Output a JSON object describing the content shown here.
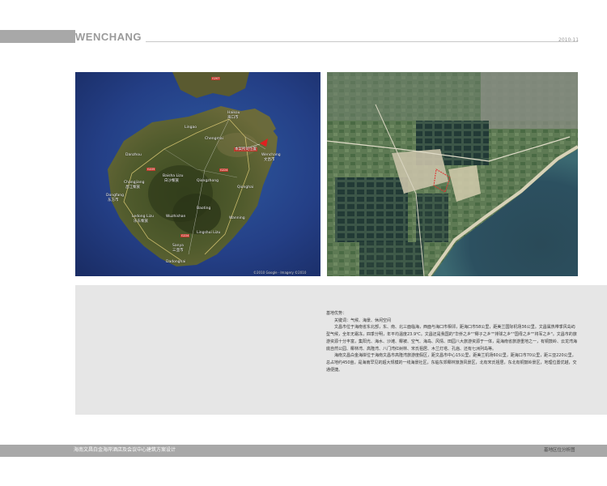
{
  "header": {
    "title": "WENCHANG",
    "date": "2010-11"
  },
  "map_left": {
    "labels": [
      {
        "name": "haikou-en",
        "text": "Haikou"
      },
      {
        "name": "haikou-cn",
        "text": "海口市"
      },
      {
        "name": "lingao",
        "text": "Lingao"
      },
      {
        "name": "chengmai",
        "text": "Chengmai"
      },
      {
        "name": "project-tag",
        "text": "本案所处位置"
      },
      {
        "name": "wenchang-en",
        "text": "Wenchang"
      },
      {
        "name": "wenchang-cn",
        "text": "文昌市"
      },
      {
        "name": "baisha",
        "text": "Baisha Lizu"
      },
      {
        "name": "baisha-cn",
        "text": "白沙黎族"
      },
      {
        "name": "qiongzhong",
        "text": "Qiongzhong"
      },
      {
        "name": "qionghai",
        "text": "Qionghai"
      },
      {
        "name": "danzhou",
        "text": "Danzhou"
      },
      {
        "name": "changjiang",
        "text": "Changjiang"
      },
      {
        "name": "changjiang-cn",
        "text": "昌江黎族"
      },
      {
        "name": "dongfang",
        "text": "Dongfang"
      },
      {
        "name": "dongfang-cn",
        "text": "东方市"
      },
      {
        "name": "wanning",
        "text": "Wanning"
      },
      {
        "name": "baoting",
        "text": "Baoting"
      },
      {
        "name": "ledong",
        "text": "Ledong Lizu"
      },
      {
        "name": "ledong-cn",
        "text": "乐东黎族"
      },
      {
        "name": "wuzhishan",
        "text": "Wuzhishan"
      },
      {
        "name": "lingshui",
        "text": "Lingshui Lizu"
      },
      {
        "name": "sanya",
        "text": "Sanya"
      },
      {
        "name": "sanya-cn",
        "text": "三亚市"
      },
      {
        "name": "dadonghai",
        "text": "Dadonghai"
      },
      {
        "name": "copyright",
        "text": "©2010 Google · Imagery ©2010"
      }
    ]
  },
  "body_text": {
    "heading": "基地优势：",
    "keywords": "关键词：气候、海景、休闲空间",
    "paragraph1": "文昌市位于海南省东北部，东、南、北三面临海，西面与海口市相邻，距海口市58公里，距美兰国际机场36公里。文昌属热带季风岛屿型气候，全年无霜冻，四季分明，年平均温度23.9℃。文昌还是我国的\"华侨之乡\"\"椰子之乡\"\"排球之乡\"\"国母之乡\"\"将军之乡\"。文昌市的旅游资源十分丰富，集阳光、海水、沙滩、椰被、空气、海岛、风情、田园八大旅游资源于一体，是海南省旅游重地之一，有铜鼓岭、云龙湾海底自然公园、椰林湾、高隆湾、八门湾红树林、宋氏祖居、木兰灯塔、孔庙、还有七洲列岛等。",
    "paragraph2": "海南文昌白金海岸位于海南文昌市高隆湾旅游度假区，距文昌市中心15公里，距美兰机场60公里，距海口市70公里，距三亚220公里，总占地约450亩，是海南罕见的超大规模的一线海景社区，东临东郊椰林旅游风景区，北有宋氏祖居，东北有铜鼓岭景区，地理位置优越，交通便捷。"
  },
  "footer": {
    "project_title": "海南文昌白金海岸酒店及会议中心建筑方案设计",
    "section": "基地区位分析图"
  }
}
